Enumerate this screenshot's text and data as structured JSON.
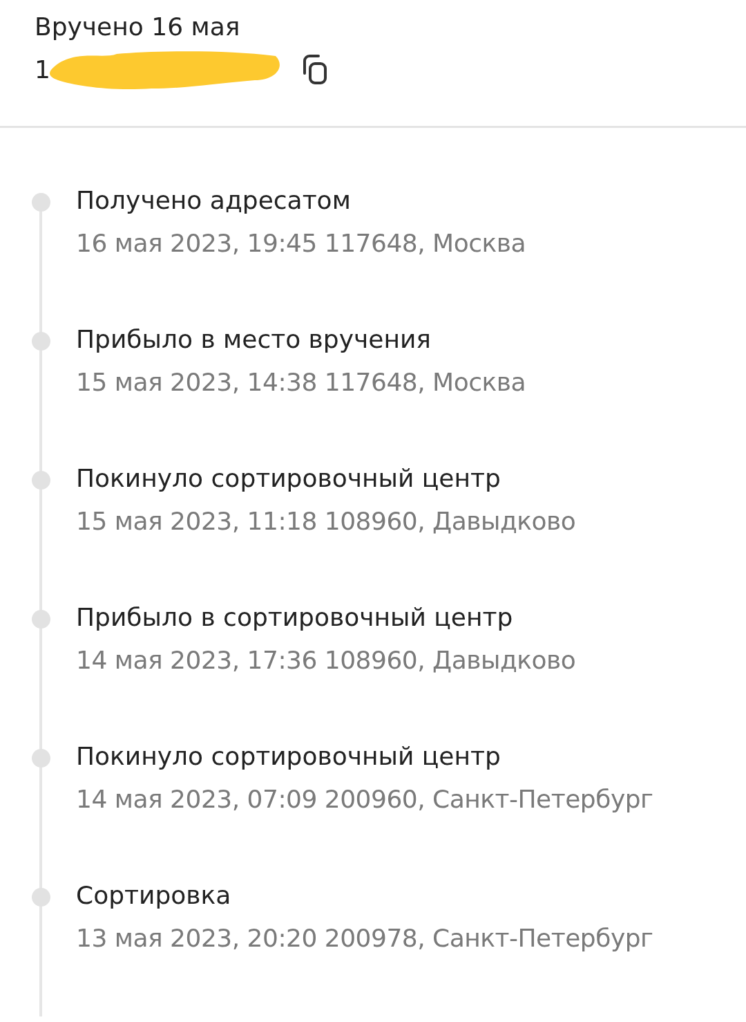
{
  "header": {
    "title": "Вручено 16 мая",
    "tracking_number": "1"
  },
  "events": [
    {
      "title": "Получено адресатом",
      "details": "16 мая 2023, 19:45 117648, Москва"
    },
    {
      "title": "Прибыло в место вручения",
      "details": "15 мая 2023, 14:38 117648, Москва"
    },
    {
      "title": "Покинуло сортировочный центр",
      "details": "15 мая 2023, 11:18 108960, Давыдково"
    },
    {
      "title": "Прибыло в сортировочный центр",
      "details": "14 мая 2023, 17:36 108960, Давыдково"
    },
    {
      "title": "Покинуло сортировочный центр",
      "details": "14 мая 2023, 07:09 200960, Санкт-Петербург"
    },
    {
      "title": "Сортировка",
      "details": "13 мая 2023, 20:20 200978, Санкт-Петербург"
    }
  ]
}
